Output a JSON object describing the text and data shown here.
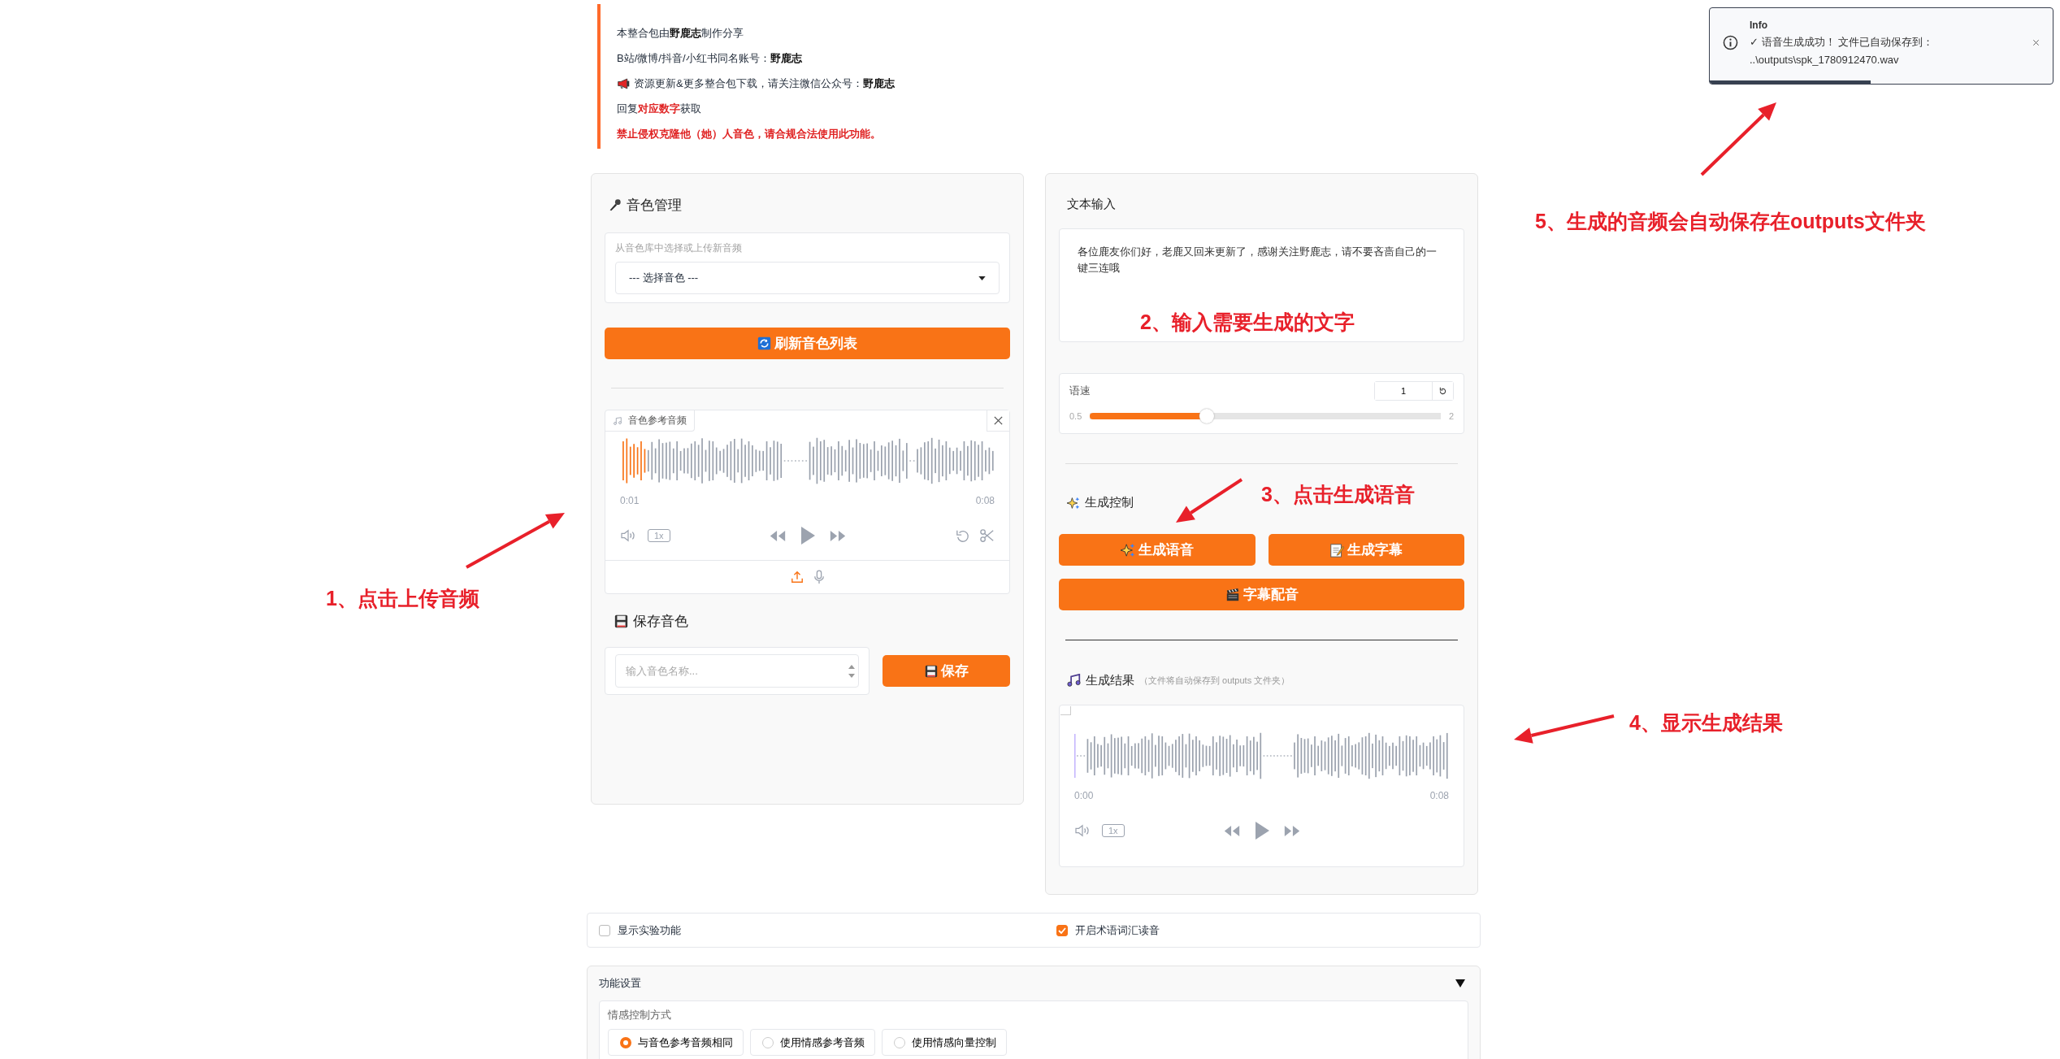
{
  "notice": {
    "lines": [
      {
        "kind": "plain",
        "text": "本整合包由**野鹿志**制作分享"
      },
      {
        "kind": "plain",
        "text": "B站/微博/抖音/小红书同名账号：**野鹿志**"
      },
      {
        "kind": "announcement",
        "text": "资源更新&更多整合包下载，请关注微信公众号：**野鹿志**"
      },
      {
        "kind": "highlight",
        "text": "回复**对应数字**获取"
      },
      {
        "kind": "warning",
        "text": "禁止侵权克隆他（她）人音色，请合规合法使用此功能。"
      }
    ]
  },
  "voice_panel": {
    "title": "音色管理",
    "select_label": "从音色库中选择或上传新音频",
    "select_value": "--- 选择音色 ---",
    "refresh_button": "刷新音色列表",
    "audio": {
      "kind": "upload",
      "label": "音色参考音频",
      "current_time": "0:01",
      "duration": "0:08",
      "level": 0.06,
      "speed": "1x"
    },
    "save_title": "保存音色",
    "name_placeholder": "输入音色名称...",
    "save_button": "保存"
  },
  "text_panel": {
    "title": "文本输入",
    "text": "各位鹿友你们好，老鹿又回来更新了，感谢关注野鹿志，请不要吝啬自己的一键三连哦",
    "speed": {
      "label": "语速",
      "value": "1",
      "min": "0.5",
      "max": "2",
      "level": 0.333
    },
    "control_title": "生成控制",
    "buttons": [
      {
        "kind": "generate",
        "label": "生成语音"
      },
      {
        "kind": "subtitle",
        "label": "生成字幕"
      },
      {
        "kind": "dub",
        "label": "字幕配音"
      }
    ],
    "result_title": "生成结果",
    "result_note": "（文件将自动保存到 outputs 文件夹）",
    "result_audio": {
      "kind": "result",
      "current_time": "0:00",
      "duration": "0:08",
      "speed": "1x"
    }
  },
  "options": [
    {
      "label": "显示实验功能",
      "checked": false
    },
    {
      "label": "开启术语词汇读音",
      "checked": true
    }
  ],
  "settings": {
    "title": "功能设置",
    "expanded": true,
    "emotion_label": "情感控制方式",
    "choices": [
      {
        "label": "与音色参考音频相同",
        "selected": true
      },
      {
        "label": "使用情感参考音频",
        "selected": false
      },
      {
        "label": "使用情感向量控制",
        "selected": false
      }
    ]
  },
  "toast": {
    "title": "Info",
    "message": "✓ 语音生成成功！ 文件已自动保存到：",
    "path": "..\\outputs\\spk_1780912470.wav",
    "level": 0.47
  },
  "annotations": [
    {
      "text": "5、生成的音频会自动保存在outputs文件夹"
    },
    {
      "text": "2、输入需要生成的文字"
    },
    {
      "text": "3、点击生成语音"
    },
    {
      "text": "1、点击上传音频"
    },
    {
      "text": "4、显示生成结果"
    }
  ]
}
